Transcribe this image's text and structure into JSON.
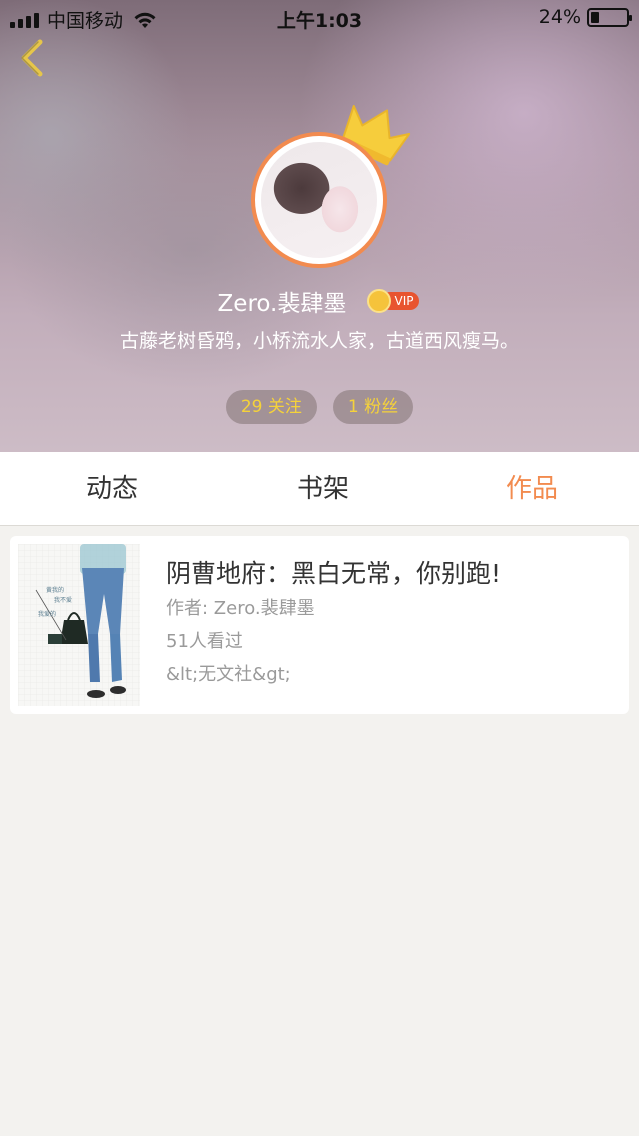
{
  "status_bar": {
    "carrier": "中国移动",
    "time": "上午1:03",
    "battery": "24%",
    "battery_level": 0.24
  },
  "profile": {
    "username": "Zero.裴肆墨",
    "vip_label": "VIP",
    "bio": "古藤老树昏鸦，小桥流水人家，古道西风瘦马。",
    "following": "29 关注",
    "followers": "1 粉丝"
  },
  "tabs": [
    {
      "label": "动态",
      "active": false
    },
    {
      "label": "书架",
      "active": false
    },
    {
      "label": "作品",
      "active": true
    }
  ],
  "works": [
    {
      "title": "阴曹地府：黑白无常，你别跑!",
      "author": "作者: Zero.裴肆墨",
      "views": "51人看过",
      "tag": "&lt;无文社&gt;"
    }
  ],
  "colors": {
    "accent": "#f28b4f",
    "stat_text": "#f5d23a",
    "vip": "#e8542f",
    "page_bg": "#f3f2ef"
  },
  "icons": [
    "back-chevron-icon",
    "crown-icon",
    "vip-medal-icon",
    "wifi-icon",
    "signal-icon",
    "battery-icon"
  ]
}
